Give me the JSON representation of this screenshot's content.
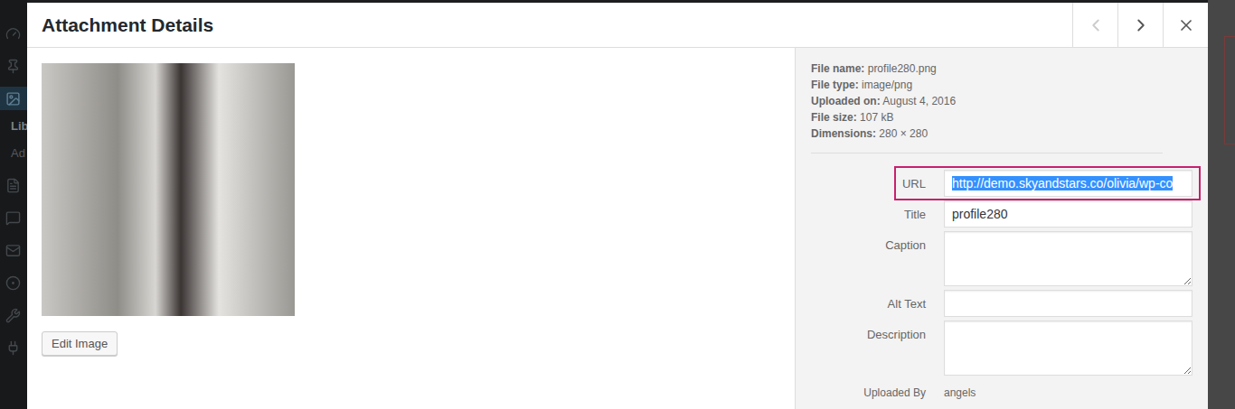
{
  "admin_menu": {
    "items": [
      {
        "label": "Lib",
        "selected": true
      },
      {
        "label": "Ad",
        "selected": false
      }
    ]
  },
  "modal": {
    "title": "Attachment Details",
    "nav": {
      "previous_disabled": true,
      "next_disabled": false
    },
    "edit_button": "Edit Image",
    "details": [
      {
        "label": "File name:",
        "value": "profile280.png"
      },
      {
        "label": "File type:",
        "value": "image/png"
      },
      {
        "label": "Uploaded on:",
        "value": "August 4, 2016"
      },
      {
        "label": "File size:",
        "value": "107 kB"
      },
      {
        "label": "Dimensions:",
        "value": "280 × 280"
      }
    ],
    "fields": [
      {
        "label": "URL",
        "value": "http://demo.skyandstars.co/olivia/wp-co",
        "kind": "input",
        "highlighted": true,
        "selected": true
      },
      {
        "label": "Title",
        "value": "profile280",
        "kind": "input",
        "highlighted": false,
        "selected": false
      },
      {
        "label": "Caption",
        "value": "",
        "kind": "textarea",
        "highlighted": false,
        "selected": false
      },
      {
        "label": "Alt Text",
        "value": "",
        "kind": "input",
        "highlighted": false,
        "selected": false
      },
      {
        "label": "Description",
        "value": "",
        "kind": "textarea",
        "highlighted": false,
        "selected": false
      }
    ],
    "uploaded_by": {
      "label": "Uploaded By",
      "value": "angels"
    }
  }
}
